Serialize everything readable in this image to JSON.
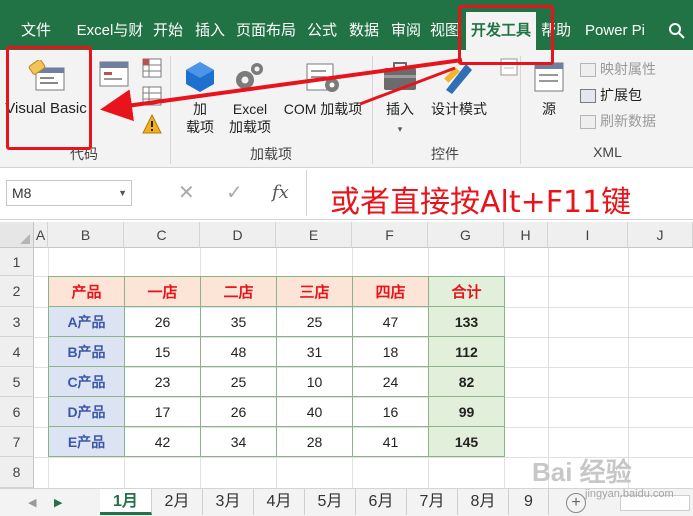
{
  "ribbon_tabs": [
    {
      "label": "文件",
      "active": false
    },
    {
      "label": "Excel与财",
      "active": false
    },
    {
      "label": "开始",
      "active": false
    },
    {
      "label": "插入",
      "active": false
    },
    {
      "label": "页面布局",
      "active": false
    },
    {
      "label": "公式",
      "active": false
    },
    {
      "label": "数据",
      "active": false
    },
    {
      "label": "审阅",
      "active": false
    },
    {
      "label": "视图",
      "active": false
    },
    {
      "label": "开发工具",
      "active": true
    },
    {
      "label": "帮助",
      "active": false
    },
    {
      "label": "Power Pi",
      "active": false
    }
  ],
  "ribbon": {
    "code_group": {
      "label": "代码",
      "visual_basic": "Visual Basic"
    },
    "addins_group": {
      "label": "加载项",
      "addins": "加\n载项",
      "excel_addins": "Excel\n加载项",
      "com_addins": "COM 加载项"
    },
    "controls_group": {
      "label": "控件",
      "insert": "插入",
      "design_mode": "设计模式"
    },
    "xml_group": {
      "label": "XML",
      "source": "源",
      "map_properties": "映射属性",
      "expansion_packs": "扩展包",
      "refresh_data": "刷新数据"
    }
  },
  "formula_bar": {
    "name_box": "M8",
    "formula": ""
  },
  "annotation_text": "或者直接按Alt+F11键",
  "columns": [
    "A",
    "B",
    "C",
    "D",
    "E",
    "F",
    "G",
    "H",
    "I",
    "J"
  ],
  "rows": [
    "1",
    "2",
    "3",
    "4",
    "5",
    "6",
    "7",
    "8"
  ],
  "table": {
    "headers": [
      "产品",
      "一店",
      "二店",
      "三店",
      "四店",
      "合计"
    ],
    "rows": [
      [
        "A产品",
        "26",
        "35",
        "25",
        "47",
        "133"
      ],
      [
        "B产品",
        "15",
        "48",
        "31",
        "18",
        "112"
      ],
      [
        "C产品",
        "23",
        "25",
        "10",
        "24",
        "82"
      ],
      [
        "D产品",
        "17",
        "26",
        "40",
        "16",
        "99"
      ],
      [
        "E产品",
        "42",
        "34",
        "28",
        "41",
        "145"
      ]
    ]
  },
  "sheet_tabs": [
    {
      "label": "1月",
      "active": true
    },
    {
      "label": "2月",
      "active": false
    },
    {
      "label": "3月",
      "active": false
    },
    {
      "label": "4月",
      "active": false
    },
    {
      "label": "5月",
      "active": false
    },
    {
      "label": "6月",
      "active": false
    },
    {
      "label": "7月",
      "active": false
    },
    {
      "label": "8月",
      "active": false
    },
    {
      "label": "9",
      "active": false
    }
  ],
  "watermark": {
    "text": "Bai 经验",
    "sub": "jingyan.baidu.com"
  },
  "colors": {
    "excel_green": "#217346",
    "highlight_red": "#e8141b",
    "header_fill": "#fce4d6",
    "label_fill": "#dce3f2",
    "total_fill": "#e2efda"
  }
}
